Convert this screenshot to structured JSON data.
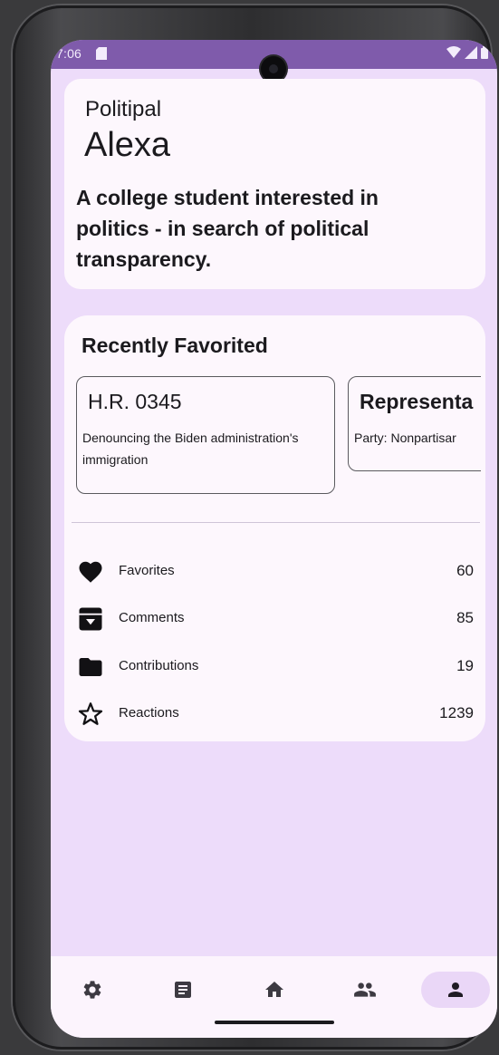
{
  "status_bar": {
    "time": "7:06",
    "icons": [
      "sd-card-icon",
      "wifi-icon",
      "signal-icon",
      "battery-icon"
    ]
  },
  "profile": {
    "role": "Politipal",
    "name": "Alexa",
    "bio": "A college student interested in politics - in search of political transparency."
  },
  "favorites": {
    "title": "Recently Favorited",
    "items": [
      {
        "title": "H.R. 0345",
        "description": "Denouncing the Biden administration's immigration"
      },
      {
        "title": "Representa",
        "description": "Party: Nonpartisar"
      }
    ]
  },
  "stats": [
    {
      "icon": "heart-icon",
      "label": "Favorites",
      "value": "60"
    },
    {
      "icon": "archive-icon",
      "label": "Comments",
      "value": "85"
    },
    {
      "icon": "folder-icon",
      "label": "Contributions",
      "value": "19"
    },
    {
      "icon": "star-outline-icon",
      "label": "Reactions",
      "value": "1239"
    }
  ],
  "nav": [
    {
      "icon": "settings-icon",
      "active": false
    },
    {
      "icon": "document-icon",
      "active": false
    },
    {
      "icon": "home-icon",
      "active": false
    },
    {
      "icon": "people-icon",
      "active": false
    },
    {
      "icon": "person-icon",
      "active": true
    }
  ],
  "colors": {
    "status_bar": "#7f5bab",
    "background": "#eddcfa",
    "card": "#fdf7fd",
    "active_nav": "#ead7f7",
    "text": "#1b1a1e"
  }
}
